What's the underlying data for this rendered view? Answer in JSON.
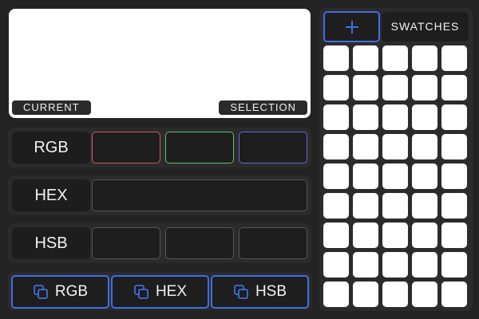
{
  "preview": {
    "current_label": "CURRENT",
    "selection_label": "SELECTION",
    "current_color": "#ffffff",
    "selection_color": "#ffffff"
  },
  "rows": {
    "rgb": {
      "label": "RGB",
      "r_value": "",
      "g_value": "",
      "b_value": ""
    },
    "hex": {
      "label": "HEX",
      "value": ""
    },
    "hsb": {
      "label": "HSB",
      "h_value": "",
      "s_value": "",
      "b_value": ""
    }
  },
  "copy_buttons": {
    "rgb_label": "RGB",
    "hex_label": "HEX",
    "hsb_label": "HSB",
    "icon": "copy-icon"
  },
  "swatches": {
    "add_icon": "plus-icon",
    "title": "SWATCHES",
    "columns": 5,
    "rows": 9,
    "color": "#ffffff"
  },
  "colors": {
    "accent": "#3f6fe0",
    "red_channel": "#d05a5a",
    "green_channel": "#5cc06e",
    "blue_channel": "#6a6ad8",
    "background": "#232323"
  }
}
